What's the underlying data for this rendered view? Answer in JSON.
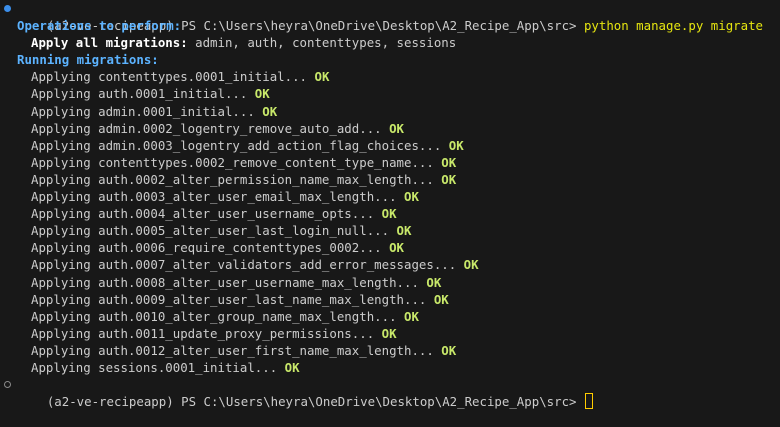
{
  "terminal": {
    "prompt_1": "(a2-ve-recipeapp) PS C:\\Users\\heyra\\OneDrive\\Desktop\\A2_Recipe_App\\src> ",
    "command": "python manage.py migrate",
    "ops_heading": "Operations to perform:",
    "apply_all_label": "Apply all migrations:",
    "apply_all_value": " admin, auth, contenttypes, sessions",
    "running_heading": "Running migrations:",
    "ok_label": "OK",
    "migrations": [
      "Applying contenttypes.0001_initial... ",
      "Applying auth.0001_initial... ",
      "Applying admin.0001_initial... ",
      "Applying admin.0002_logentry_remove_auto_add... ",
      "Applying admin.0003_logentry_add_action_flag_choices... ",
      "Applying contenttypes.0002_remove_content_type_name... ",
      "Applying auth.0002_alter_permission_name_max_length... ",
      "Applying auth.0003_alter_user_email_max_length... ",
      "Applying auth.0004_alter_user_username_opts... ",
      "Applying auth.0005_alter_user_last_login_null... ",
      "Applying auth.0006_require_contenttypes_0002... ",
      "Applying auth.0007_alter_validators_add_error_messages... ",
      "Applying auth.0008_alter_user_username_max_length... ",
      "Applying auth.0009_alter_user_last_name_max_length... ",
      "Applying auth.0010_alter_group_name_max_length... ",
      "Applying auth.0011_update_proxy_permissions... ",
      "Applying auth.0012_alter_user_first_name_max_length... ",
      "Applying sessions.0001_initial... "
    ],
    "prompt_2": "(a2-ve-recipeapp) PS C:\\Users\\heyra\\OneDrive\\Desktop\\A2_Recipe_App\\src> "
  },
  "colors": {
    "background": "#181818",
    "command": "#e5e510",
    "heading": "#5cb3ff",
    "ok": "#c8e86a",
    "decoration_success": "#3b8eea",
    "cursor": "#ffcc00"
  },
  "icons": {
    "command_decoration_success": "circle-filled-icon",
    "command_decoration_pending": "circle-outline-icon"
  }
}
